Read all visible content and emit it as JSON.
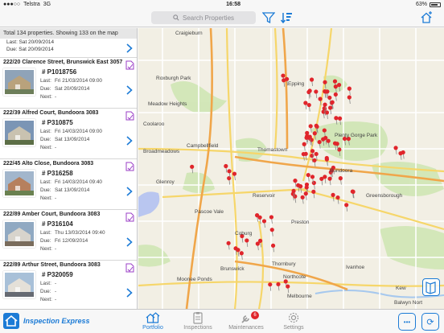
{
  "status": {
    "carrier": "Telstra",
    "network": "3G",
    "time": "16:58",
    "battery": "63%"
  },
  "nav": {
    "search_placeholder": "Search Properties"
  },
  "summary": "Total 134 properties. Showing 133 on the map",
  "first_item": {
    "last": "Sat 20/09/2014",
    "due": "Sat 20/09/2014"
  },
  "properties": [
    {
      "address": "222/20 Clarence Street, Brunswick East 3057",
      "id": "# P1018756",
      "last": "Fri 21/03/2014 09:00",
      "due": "Sat 20/09/2014",
      "next": "-"
    },
    {
      "address": "222/39 Alfred Court, Bundoora 3083",
      "id": "# P310875",
      "last": "Fri 14/03/2014 09:00",
      "due": "Sat 13/09/2014",
      "next": "-"
    },
    {
      "address": "222/45 Alto Close, Bundoora 3083",
      "id": "# P316258",
      "last": "Fri 14/03/2014 09:40",
      "due": "Sat 13/09/2014",
      "next": "-"
    },
    {
      "address": "222/89 Amber Court, Bundoora 3083",
      "id": "# P316104",
      "last": "Thu 13/03/2014 09:40",
      "due": "Fri 12/09/2014",
      "next": "-"
    },
    {
      "address": "222/89 Arthur Street, Bundoora 3083",
      "id": "# P320059",
      "last": "-",
      "due": "-",
      "next": "-"
    }
  ],
  "field_labels": {
    "last": "Last:",
    "due": "Due:",
    "next": "Next:"
  },
  "map_labels": [
    {
      "text": "Craigieburn"
    },
    {
      "text": "Roxburgh Park"
    },
    {
      "text": "Meadow Heights"
    },
    {
      "text": "Coolaroo"
    },
    {
      "text": "Broadmeadows"
    },
    {
      "text": "Campbellfield"
    },
    {
      "text": "Epping"
    },
    {
      "text": "Thomastown"
    },
    {
      "text": "Plenty Gorge Park"
    },
    {
      "text": "Bundoora"
    },
    {
      "text": "Greensborough"
    },
    {
      "text": "Glenroy"
    },
    {
      "text": "Reservoir"
    },
    {
      "text": "Pascoe Vale"
    },
    {
      "text": "Coburg"
    },
    {
      "text": "Preston"
    },
    {
      "text": "Brunswick"
    },
    {
      "text": "Thornbury"
    },
    {
      "text": "Northcote"
    },
    {
      "text": "Moonee Ponds"
    },
    {
      "text": "Ivanhoe"
    },
    {
      "text": "Kew"
    },
    {
      "text": "Melbourne"
    },
    {
      "text": "Balwyn Nort"
    }
  ],
  "brand": {
    "name": "Inspection Express"
  },
  "tabs": [
    {
      "label": "Portfolio",
      "active": true
    },
    {
      "label": "Inspections",
      "active": false
    },
    {
      "label": "Maintenances",
      "active": false,
      "badge": "6"
    },
    {
      "label": "Settings",
      "active": false
    }
  ],
  "buttons": {
    "more": "•••",
    "sync": "⟳"
  },
  "colors": {
    "accent": "#1c7bd6",
    "pin": "#e0252b",
    "note": "#9b3fc7"
  }
}
